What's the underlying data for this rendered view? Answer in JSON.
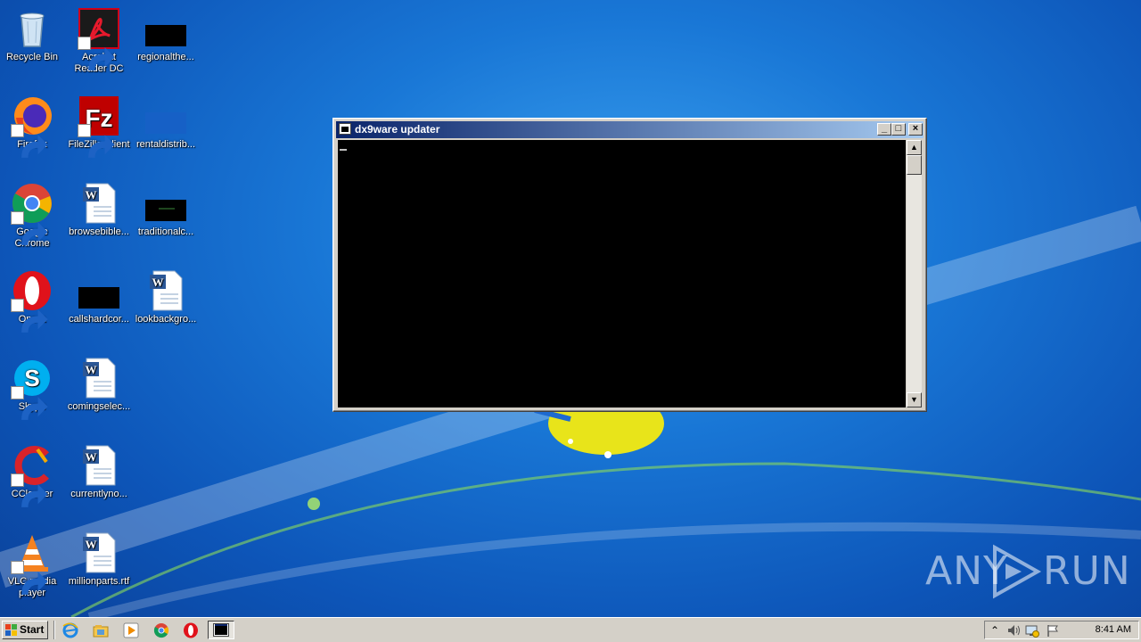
{
  "desktop": {
    "icons": [
      {
        "id": "recycle-bin",
        "label": "Recycle Bin",
        "icon": "recycle-bin-icon"
      },
      {
        "id": "acrobat",
        "label": "Acrobat Reader DC",
        "icon": "acrobat-icon"
      },
      {
        "id": "regional",
        "label": "regionalthe...",
        "icon": "black-thumbnail-icon"
      },
      {
        "id": "firefox",
        "label": "Firefox",
        "icon": "firefox-icon"
      },
      {
        "id": "filezilla",
        "label": "FileZilla Client",
        "icon": "filezilla-icon"
      },
      {
        "id": "rental",
        "label": "rentaldistrib...",
        "icon": "blue-thumbnail-icon"
      },
      {
        "id": "chrome",
        "label": "Google Chrome",
        "icon": "chrome-icon"
      },
      {
        "id": "browsebible",
        "label": "browsebible...",
        "icon": "word-document-icon"
      },
      {
        "id": "traditional",
        "label": "traditionalc...",
        "icon": "black-thumbnail-icon"
      },
      {
        "id": "opera",
        "label": "Opera",
        "icon": "opera-icon"
      },
      {
        "id": "callshard",
        "label": "callshardcor...",
        "icon": "black-thumbnail-icon"
      },
      {
        "id": "lookback",
        "label": "lookbackgro...",
        "icon": "word-document-icon"
      },
      {
        "id": "skype",
        "label": "Skype",
        "icon": "skype-icon"
      },
      {
        "id": "comingselec",
        "label": "comingselec...",
        "icon": "word-document-icon"
      },
      {
        "id": "ccleaner",
        "label": "CCleaner",
        "icon": "ccleaner-icon"
      },
      {
        "id": "currentlyno",
        "label": "currentlyno...",
        "icon": "word-document-icon"
      },
      {
        "id": "vlc",
        "label": "VLC media player",
        "icon": "vlc-icon"
      },
      {
        "id": "millionparts",
        "label": "millionparts.rtf",
        "icon": "word-document-icon"
      }
    ]
  },
  "console_window": {
    "title": "dx9ware updater",
    "minimize_label": "_",
    "maximize_label": "□",
    "close_label": "×",
    "scroll_up": "▲",
    "scroll_down": "▼"
  },
  "taskbar": {
    "start_label": "Start",
    "quick_launch": [
      "internet-explorer-icon",
      "explorer-icon",
      "media-player-icon",
      "chrome-icon",
      "opera-icon"
    ],
    "active_task_icon": "console-icon",
    "tray_icons": [
      "show-hidden-icons-icon",
      "volume-icon",
      "network-icon",
      "action-center-flag-icon"
    ],
    "clock": "8:41 AM"
  },
  "watermark": {
    "left": "ANY",
    "right": "RUN"
  },
  "colors": {
    "title_bar_start": "#0a246a",
    "title_bar_end": "#a6caf0",
    "desktop": "#1977d6"
  }
}
